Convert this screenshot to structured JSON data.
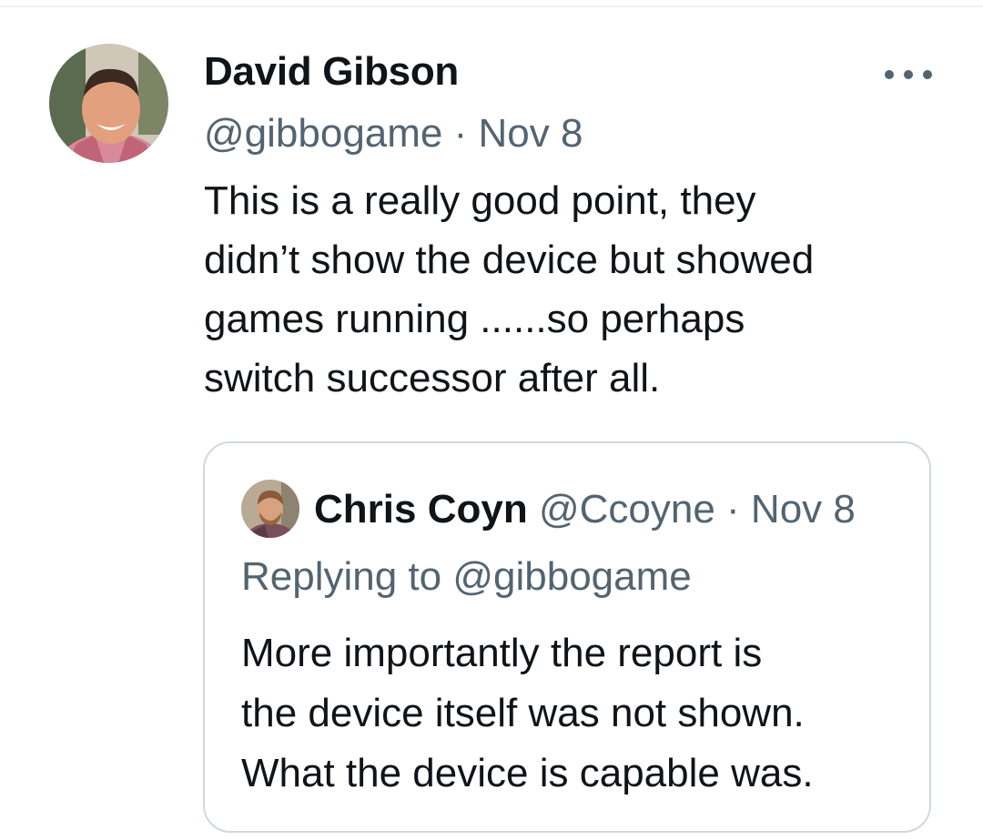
{
  "tweet": {
    "author_name": "David Gibson",
    "handle": "@gibbogame",
    "separator": "·",
    "date": "Nov 8",
    "text_lines": [
      "This is a really good point, they",
      "didn’t show the device but showed",
      "games running ......so perhaps",
      "switch successor after all."
    ],
    "more_icon": "more-horizontal-icon"
  },
  "quote": {
    "author_name": "Chris Coyn",
    "handle": "@Ccoyne",
    "separator": "·",
    "date": "Nov 8",
    "replying_to": "Replying to @gibbogame",
    "text_lines": [
      "More importantly the report is",
      "the device itself was not shown.",
      "What the device is capable was."
    ]
  },
  "colors": {
    "text_primary": "#0f1419",
    "text_secondary": "#536471",
    "border": "#cfd9de",
    "divider": "#eff3f4"
  }
}
